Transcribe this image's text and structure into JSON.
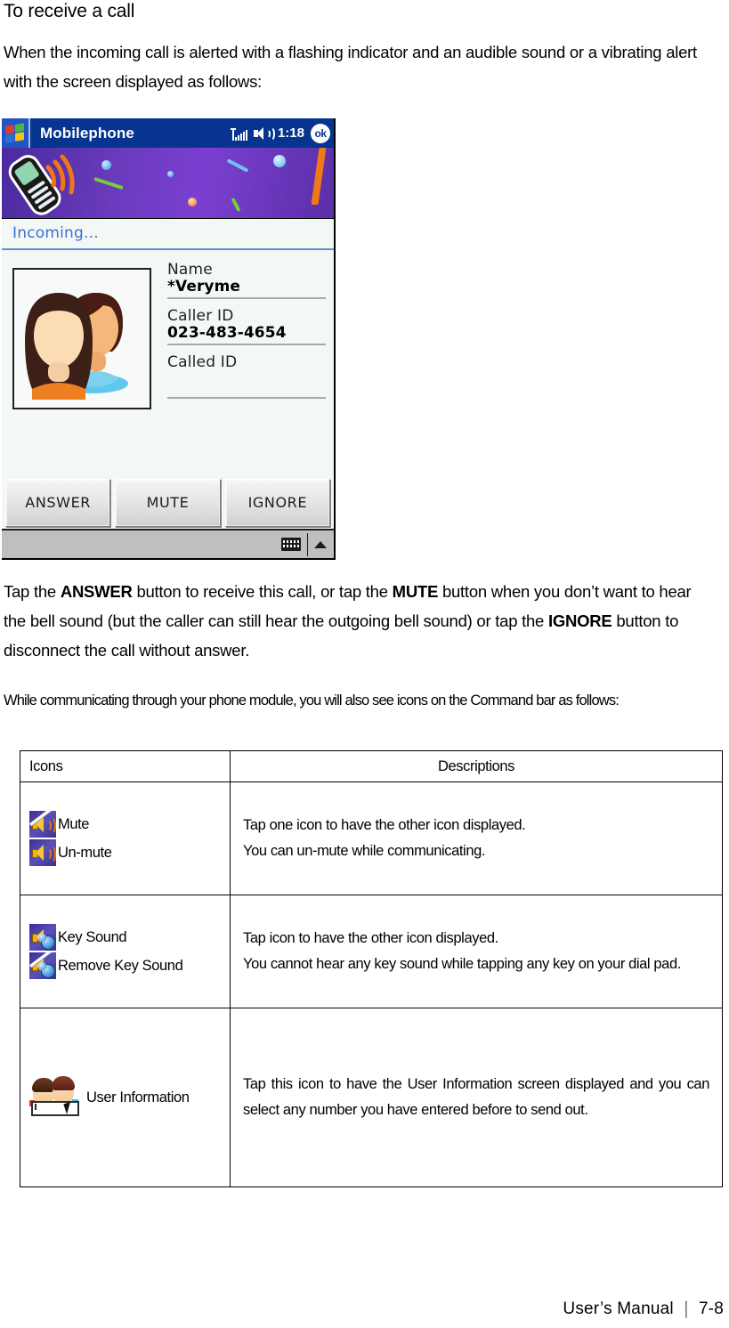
{
  "page": {
    "heading": "To receive a call",
    "intro": "When the incoming call is alerted with a flashing indicator and an audible sound or a vibrating alert with the screen displayed as follows:",
    "while_line": "While communicating through your phone module, you will also see icons on the Command bar as follows:",
    "tap_paragraph": {
      "seg1": "Tap the ",
      "b1": "ANSWER",
      "seg2": " button to receive this call, or tap the ",
      "b2": "MUTE",
      "seg3": " button when you don’t want to hear the bell sound (but the caller can still hear the outgoing bell sound) or tap the ",
      "b3": "IGNORE",
      "seg4": " button to disconnect the call without answer."
    }
  },
  "pda": {
    "titlebar": {
      "logo_icon": "windows-logo-icon",
      "title": "Mobilephone",
      "signal_icon": "signal-strength-icon",
      "speaker_icon": "speaker-volume-icon",
      "clock": "1:18",
      "ok_label": "ok"
    },
    "banner": {
      "art_icon": "ringing-mobile-phone-icon",
      "bg_color": "#6a3bbd"
    },
    "status_label": "Incoming...",
    "fields": [
      {
        "label": "Name",
        "value": "*Veryme"
      },
      {
        "label": "Caller ID",
        "value": "023-483-4654"
      },
      {
        "label": "Called ID",
        "value": ""
      }
    ],
    "avatar_icon": "two-contacts-photo-icon",
    "buttons": [
      {
        "label": "ANSWER"
      },
      {
        "label": "MUTE"
      },
      {
        "label": "IGNORE"
      }
    ],
    "commandbar": {
      "keyboard_icon": "soft-keyboard-icon",
      "arrow_icon": "input-panel-chevron-up-icon"
    }
  },
  "table": {
    "headers": {
      "icons": "Icons",
      "descriptions": "Descriptions"
    },
    "rows": [
      {
        "icons": [
          {
            "icon": "mute-speaker-icon",
            "label": "Mute"
          },
          {
            "icon": "unmute-speaker-icon",
            "label": "Un-mute"
          }
        ],
        "description_lines": [
          "Tap one icon to have the other icon displayed.",
          "You can un-mute while communicating."
        ]
      },
      {
        "icons": [
          {
            "icon": "key-sound-icon",
            "label": "Key Sound"
          },
          {
            "icon": "remove-key-sound-icon",
            "label": "Remove Key Sound"
          }
        ],
        "description_lines": [
          "Tap icon to have the other icon displayed.",
          "You cannot hear any key sound while tapping any key on your dial pad."
        ]
      },
      {
        "icons": [
          {
            "icon": "user-information-icon",
            "label": "User Information"
          }
        ],
        "description_lines": [
          "Tap this icon to have the User Information screen displayed and you can select any number you have entered before to send out."
        ]
      }
    ]
  },
  "footer": {
    "manual_label": "User’s Manual",
    "separator": "❘",
    "page_number": "7-8"
  }
}
